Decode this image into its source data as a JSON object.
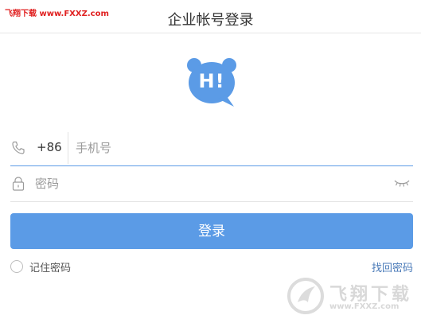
{
  "watermark": {
    "top_text": "飞翔下载 www.FXXZ.com",
    "brand": "飞翔下载",
    "url": "www.FXXZ.com"
  },
  "header": {
    "title": "企业帐号登录"
  },
  "logo": {
    "text": "H!",
    "color": "#5b9be6",
    "icon": "speech-bubble-logo"
  },
  "phone": {
    "icon": "phone-icon",
    "country_code": "+86",
    "placeholder": "手机号",
    "value": ""
  },
  "password": {
    "icon": "lock-icon",
    "placeholder": "密码",
    "value": "",
    "toggle_icon": "eye-closed-icon"
  },
  "login_button": {
    "label": "登录",
    "color": "#5b9be6"
  },
  "remember": {
    "label": "记住密码",
    "checked": false
  },
  "forgot_link": {
    "label": "找回密码"
  }
}
